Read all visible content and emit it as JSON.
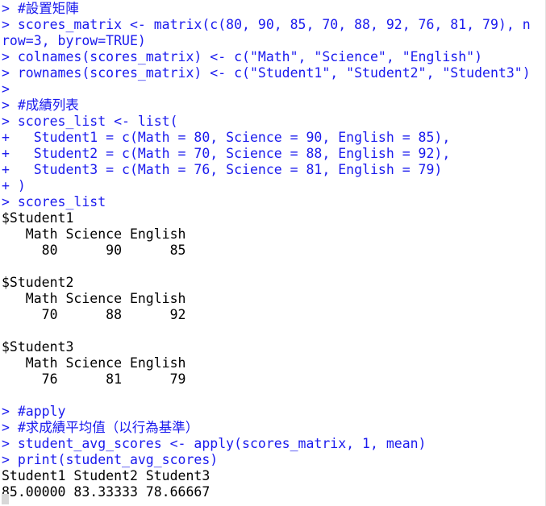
{
  "window": {
    "app": "R Console",
    "prompt_symbol": ">",
    "continuation_symbol": "+",
    "colors": {
      "background": "#ffffff",
      "input_text": "#1a1aee",
      "output_text": "#000000",
      "border": "#e3e3e3",
      "cursor": "#d8d8d8"
    }
  },
  "session": {
    "lines": [
      {
        "id": 0,
        "kind": "input",
        "text": "> #設置矩陣"
      },
      {
        "id": 1,
        "kind": "input",
        "text": "> scores_matrix <- matrix(c(80, 90, 85, 70, 88, 92, 76, 81, 79), n"
      },
      {
        "id": 2,
        "kind": "input",
        "text": "row=3, byrow=TRUE)"
      },
      {
        "id": 3,
        "kind": "input",
        "text": "> colnames(scores_matrix) <- c(\"Math\", \"Science\", \"English\")"
      },
      {
        "id": 4,
        "kind": "input",
        "text": "> rownames(scores_matrix) <- c(\"Student1\", \"Student2\", \"Student3\")"
      },
      {
        "id": 5,
        "kind": "input",
        "text": ">"
      },
      {
        "id": 6,
        "kind": "input",
        "text": "> #成績列表"
      },
      {
        "id": 7,
        "kind": "input",
        "text": "> scores_list <- list("
      },
      {
        "id": 8,
        "kind": "input",
        "text": "+   Student1 = c(Math = 80, Science = 90, English = 85),"
      },
      {
        "id": 9,
        "kind": "input",
        "text": "+   Student2 = c(Math = 70, Science = 88, English = 92),"
      },
      {
        "id": 10,
        "kind": "input",
        "text": "+   Student3 = c(Math = 76, Science = 81, English = 79)"
      },
      {
        "id": 11,
        "kind": "input",
        "text": "+ )"
      },
      {
        "id": 12,
        "kind": "input",
        "text": "> scores_list"
      },
      {
        "id": 13,
        "kind": "output",
        "text": "$Student1"
      },
      {
        "id": 14,
        "kind": "output",
        "text": "   Math Science English"
      },
      {
        "id": 15,
        "kind": "output",
        "text": "     80      90      85"
      },
      {
        "id": 16,
        "kind": "blank",
        "text": ""
      },
      {
        "id": 17,
        "kind": "output",
        "text": "$Student2"
      },
      {
        "id": 18,
        "kind": "output",
        "text": "   Math Science English"
      },
      {
        "id": 19,
        "kind": "output",
        "text": "     70      88      92"
      },
      {
        "id": 20,
        "kind": "blank",
        "text": ""
      },
      {
        "id": 21,
        "kind": "output",
        "text": "$Student3"
      },
      {
        "id": 22,
        "kind": "output",
        "text": "   Math Science English"
      },
      {
        "id": 23,
        "kind": "output",
        "text": "     76      81      79"
      },
      {
        "id": 24,
        "kind": "blank",
        "text": ""
      },
      {
        "id": 25,
        "kind": "input",
        "text": "> #apply"
      },
      {
        "id": 26,
        "kind": "input",
        "text": "> #求成績平均值（以行為基準）"
      },
      {
        "id": 27,
        "kind": "input",
        "text": "> student_avg_scores <- apply(scores_matrix, 1, mean)"
      },
      {
        "id": 28,
        "kind": "input",
        "text": "> print(student_avg_scores)"
      },
      {
        "id": 29,
        "kind": "output",
        "text": "Student1 Student2 Student3"
      },
      {
        "id": 30,
        "kind": "output",
        "text": "85.00000 83.33333 78.66667"
      }
    ]
  },
  "data_values": {
    "matrix": {
      "name": "scores_matrix",
      "nrow": 3,
      "byrow": true,
      "colnames": [
        "Math",
        "Science",
        "English"
      ],
      "rownames": [
        "Student1",
        "Student2",
        "Student3"
      ],
      "values": [
        80,
        90,
        85,
        70,
        88,
        92,
        76,
        81,
        79
      ]
    },
    "list": {
      "name": "scores_list",
      "entries": [
        {
          "key": "$Student1",
          "subjects": [
            "Math",
            "Science",
            "English"
          ],
          "scores": [
            80,
            90,
            85
          ]
        },
        {
          "key": "$Student2",
          "subjects": [
            "Math",
            "Science",
            "English"
          ],
          "scores": [
            70,
            88,
            92
          ]
        },
        {
          "key": "$Student3",
          "subjects": [
            "Math",
            "Science",
            "English"
          ],
          "scores": [
            76,
            81,
            79
          ]
        }
      ]
    },
    "averages": {
      "name": "student_avg_scores",
      "labels": [
        "Student1",
        "Student2",
        "Student3"
      ],
      "values": [
        "85.00000",
        "83.33333",
        "78.66667"
      ]
    }
  }
}
